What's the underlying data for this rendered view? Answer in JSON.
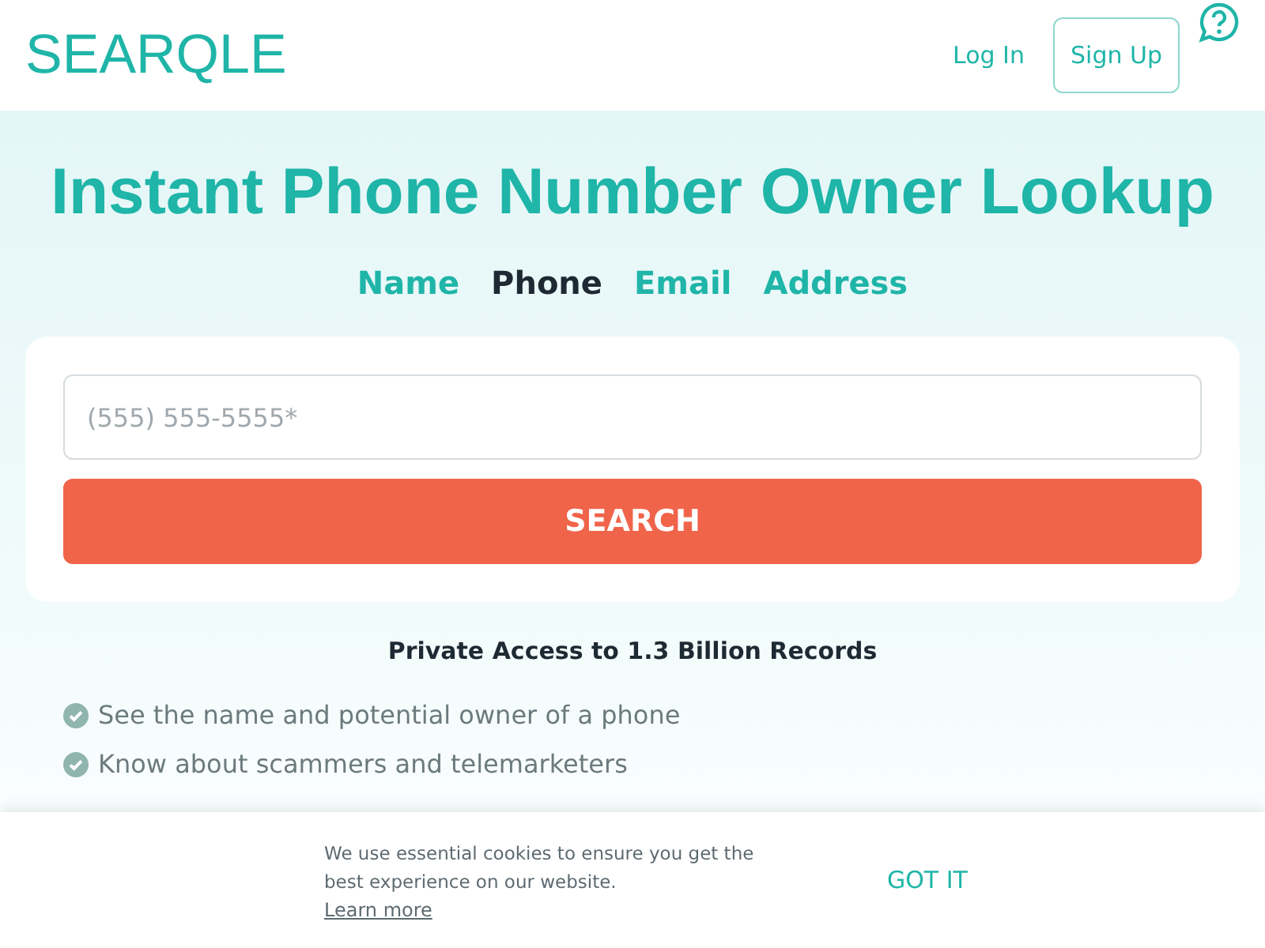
{
  "header": {
    "logo": "SEARQLE",
    "login": "Log In",
    "signup": "Sign Up"
  },
  "hero": {
    "title": "Instant Phone Number Owner Lookup",
    "tabs": [
      {
        "label": "Name",
        "selected": false
      },
      {
        "label": "Phone",
        "selected": true
      },
      {
        "label": "Email",
        "selected": false
      },
      {
        "label": "Address",
        "selected": false
      }
    ],
    "search": {
      "placeholder": "(555) 555-5555*",
      "button": "SEARCH"
    },
    "tagline": "Private Access to 1.3 Billion Records",
    "features": [
      "See the name and potential owner of a phone",
      "Know about scammers and telemarketers"
    ]
  },
  "cookie_banner": {
    "text": "We use essential cookies to ensure you get the best experience on our website.",
    "link": "Learn more",
    "button": "GOT IT"
  }
}
